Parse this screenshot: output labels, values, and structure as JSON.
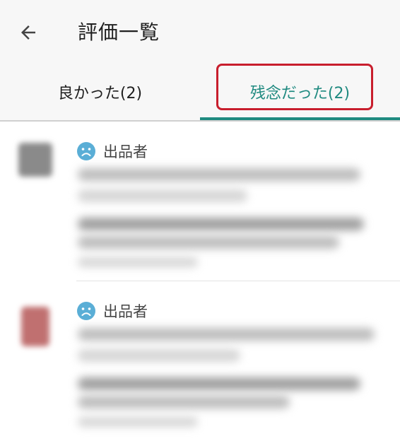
{
  "header": {
    "back_icon": "arrow-left-icon",
    "title": "評価一覧"
  },
  "tabs": [
    {
      "label": "良かった(2)",
      "selected": false
    },
    {
      "label": "残念だった(2)",
      "selected": true
    }
  ],
  "colors": {
    "accent": "#1f8a80",
    "highlight_box": "#c81e2d",
    "sad_icon": "#5aaed6"
  },
  "reviews": [
    {
      "icon": "sad-face-icon",
      "role": "出品者"
    },
    {
      "icon": "sad-face-icon",
      "role": "出品者"
    }
  ]
}
